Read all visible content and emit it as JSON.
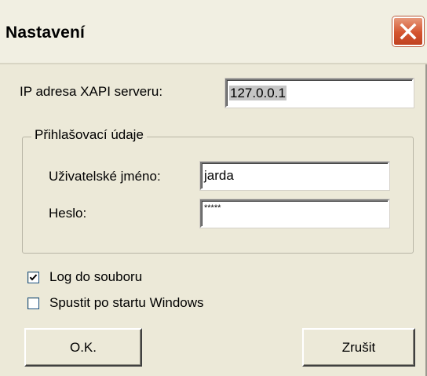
{
  "dialog": {
    "title": "Nastavení"
  },
  "server": {
    "ip_label": "IP adresa XAPI serveru:",
    "ip_value": "127.0.0.1"
  },
  "credentials": {
    "group_label": "Přihlašovací údaje",
    "username_label": "Uživatelské jméno:",
    "username_value": "jarda",
    "password_label": "Heslo:",
    "password_masked": "*****"
  },
  "options": {
    "log_label": "Log do souboru",
    "log_checked": true,
    "startup_label": "Spustit po startu Windows",
    "startup_checked": false
  },
  "buttons": {
    "ok_label": "O.K.",
    "cancel_label": "Zrušit"
  },
  "icons": {
    "close": "close-icon",
    "check": "check-icon"
  },
  "colors": {
    "close_button": "#d4542f",
    "dialog_background": "#ece9d8",
    "selection": "#c5c5c5"
  }
}
